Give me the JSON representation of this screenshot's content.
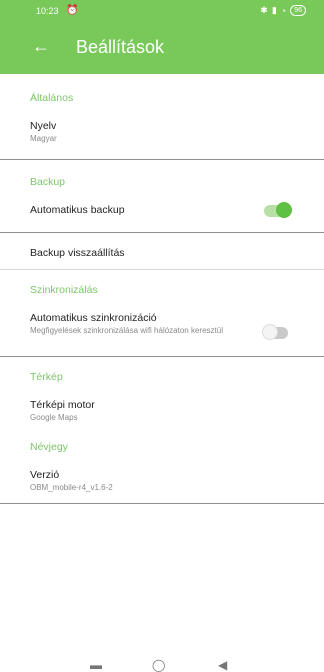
{
  "status_bar": {
    "time": "10:23",
    "battery": "96",
    "alarm_icon": "alarm-icon",
    "signal_icons": "bluetooth-signal-wifi-icons"
  },
  "appbar": {
    "title": "Beállítások",
    "back_icon": "arrow-left-icon"
  },
  "sections": {
    "general": {
      "title": "Általános",
      "language_label": "Nyelv",
      "language_value": "Magyar"
    },
    "backup": {
      "title": "Backup",
      "auto_backup_label": "Automatikus backup",
      "auto_backup_on": true,
      "restore_label": "Backup visszaállítás"
    },
    "sync": {
      "title": "Szinkronizálás",
      "auto_sync_label": "Automatikus szinkronizáció",
      "auto_sync_desc": "Megfigyelések szinkronizálása wifi hálózaton keresztül",
      "auto_sync_on": false
    },
    "map": {
      "title": "Térkép",
      "engine_label": "Térképi motor",
      "engine_value": "Google Maps"
    },
    "about": {
      "title": "Névjegy",
      "version_label": "Verzió",
      "version_value": "OBM_mobile-r4_v1.6-2"
    }
  },
  "colors": {
    "primary": "#79c95a",
    "accent": "#5fc144",
    "section_title": "#7cc66a"
  }
}
